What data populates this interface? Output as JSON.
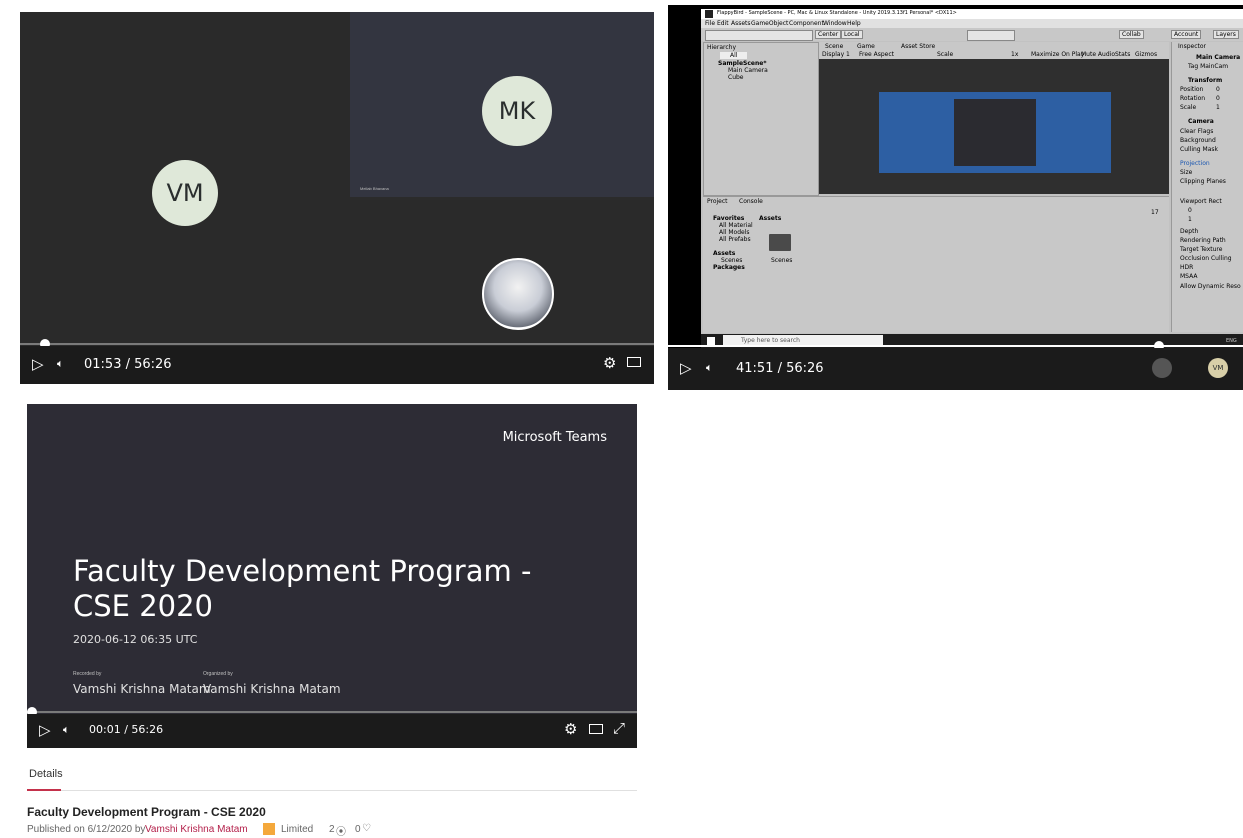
{
  "panel1": {
    "tiles": {
      "left_initials": "VM",
      "right_top_initials": "MK",
      "right_top_name": "Mellab Bhavana"
    },
    "player": {
      "time": "01:53 / 56:26",
      "progress": 0.033
    }
  },
  "panel2": {
    "unity": {
      "title": "FlappyBird - SampleScene - PC, Mac & Linux Standalone - Unity 2019.3.13f1 Personal* <DX11>",
      "menu": [
        "File",
        "Edit",
        "Assets",
        "GameObject",
        "Component",
        "Window",
        "Help"
      ],
      "toolbar": {
        "center": "Center",
        "local": "Local",
        "collab": "Collab",
        "account": "Account",
        "layers": "Layers"
      },
      "hierarchy": {
        "tab": "Hierarchy",
        "search": "All",
        "scene": "SampleScene*",
        "items": [
          "Main Camera",
          "Cube"
        ]
      },
      "scene_tabs": [
        "Scene",
        "Game",
        "Asset Store"
      ],
      "game_bar": {
        "display": "Display 1",
        "aspect": "Free Aspect",
        "scale_label": "Scale",
        "scale_value": "1x",
        "options": [
          "Maximize On Play",
          "Mute Audio",
          "Stats",
          "Gizmos"
        ]
      },
      "inspector": {
        "tab": "Inspector",
        "object": "Main Camera",
        "tag": "Tag MainCam",
        "transform_header": "Transform",
        "transform_rows": [
          {
            "label": "Position",
            "x": "0"
          },
          {
            "label": "Rotation",
            "x": "0"
          },
          {
            "label": "Scale",
            "x": "1"
          }
        ],
        "camera_header": "Camera",
        "camera_fields": [
          "Clear Flags",
          "Background",
          "Culling Mask",
          "Projection",
          "Size",
          "Clipping Planes",
          "Viewport Rect",
          "Depth",
          "Rendering Path",
          "Target Texture",
          "Occlusion Culling",
          "HDR",
          "MSAA",
          "Allow Dynamic Reso"
        ],
        "viewport_x": "0",
        "viewport_w": "1"
      },
      "project": {
        "tabs": [
          "Project",
          "Console"
        ],
        "favorites_header": "Favorites",
        "favorites": [
          "All Material",
          "All Models",
          "All Prefabs"
        ],
        "assets_header": "Assets",
        "assets_children": [
          "Scenes"
        ],
        "packages": "Packages",
        "panel_title": "Assets",
        "folder_label": "Scenes",
        "count": "17"
      }
    },
    "taskbar": {
      "search": "Type here to search",
      "lang": "ENG"
    },
    "player": {
      "time": "41:51 / 56:26",
      "progress": 0.84,
      "avatar_initials": "VM"
    }
  },
  "panel3": {
    "brand": "Microsoft Teams",
    "title": "Faculty Development Program - CSE 2020",
    "datetime": "2020-06-12 06:35 UTC",
    "recorded_by_label": "Recorded by",
    "recorded_by": "Vamshi Krishna Matam",
    "organized_by_label": "Organized by",
    "organized_by": "Vamshi Krishna Matam",
    "player": {
      "time": "00:01 / 56:26",
      "progress": 0.0
    }
  },
  "details": {
    "tab": "Details",
    "title": "Faculty Development Program - CSE 2020",
    "published_prefix": "Published on 6/12/2020 by",
    "author": "Vamshi Krishna Matam",
    "visibility": "Limited",
    "views": "2",
    "likes": "0"
  }
}
